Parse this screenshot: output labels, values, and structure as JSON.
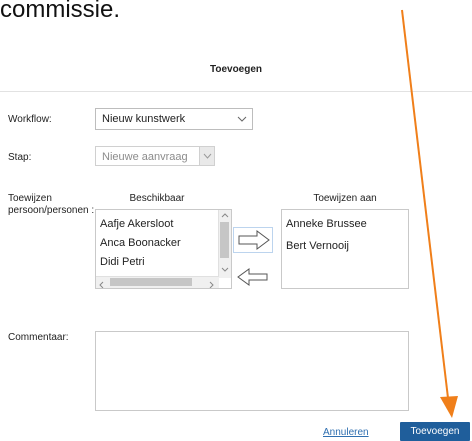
{
  "page": {
    "heading_fragment": "commissie."
  },
  "dialog": {
    "title": "Toevoegen",
    "workflow": {
      "label": "Workflow:",
      "value": "Nieuw kunstwerk"
    },
    "step": {
      "label": "Stap:",
      "value": "Nieuwe aanvraag"
    },
    "assign": {
      "label_line1": "Toewijzen",
      "label_line2": "persoon/personen :",
      "available_header": "Beschikbaar",
      "assigned_header": "Toewijzen aan",
      "available": [
        "Aafje Akersloot",
        "Anca Boonacker",
        "Didi Petri"
      ],
      "assigned": [
        "Anneke Brussee",
        "Bert Vernooij"
      ]
    },
    "comment": {
      "label": "Commentaar:"
    },
    "cancel_label": "Annuleren",
    "submit_label": "Toevoegen"
  },
  "colors": {
    "annotation_arrow": "#f07f1a",
    "primary_button": "#1f5e9b",
    "link": "#2f6fb0"
  }
}
